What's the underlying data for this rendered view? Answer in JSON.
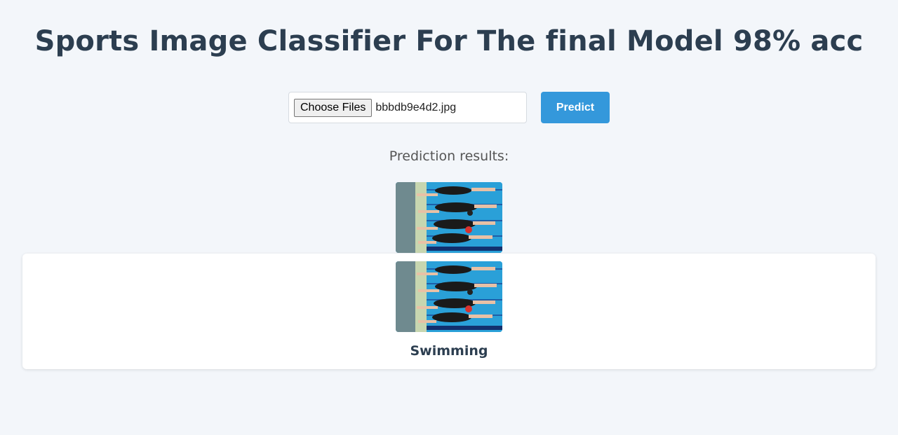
{
  "page": {
    "title": "Sports Image Classifier For The final Model 98% acc"
  },
  "upload": {
    "choose_label": "Choose Files",
    "file_name": "bbbdb9e4d2.jpg",
    "predict_label": "Predict"
  },
  "results": {
    "heading": "Prediction results:",
    "items": [
      {
        "label": "Swimming"
      }
    ]
  },
  "colors": {
    "background": "#f3f6fa",
    "title": "#2c3e50",
    "accent": "#3498db"
  }
}
